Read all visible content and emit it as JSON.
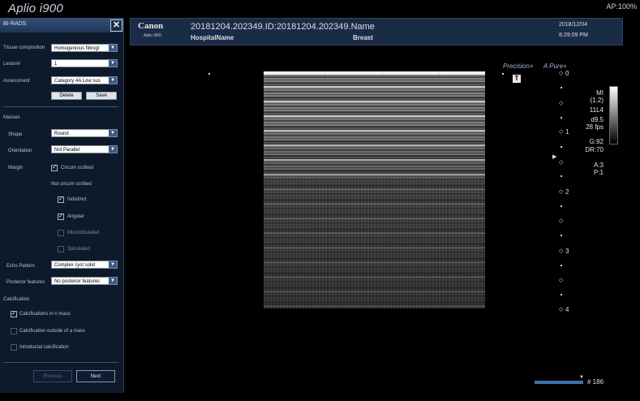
{
  "app": {
    "brand": "Aplio i900",
    "acoustic_power": "AP:100%"
  },
  "header": {
    "logo": "Canon",
    "model": "Aplio i900",
    "study_id": "20181204.202349.ID:20181204.202349.Name",
    "hospital": "HospitalName",
    "region": "Breast",
    "date": "2018/12/04",
    "time": "8:29:09 PM"
  },
  "panel": {
    "title": "BI-RADS",
    "tissue_composition_label": "Tissue composition",
    "tissue_composition_value": "Homogenious fibrogl",
    "lesion_label": "Lesion#",
    "lesion_value": "1",
    "assessment_label": "Assessment",
    "assessment_value": "Category 4A Low sus",
    "delete_label": "Delete",
    "save_label": "Save",
    "masses_heading": "Masses",
    "shape_label": "Shape",
    "shape_value": "Round",
    "orientation_label": "Orientation",
    "orientation_value": "Not Parallel",
    "margin_label": "Margin",
    "circumscribed_label": "Circum scribed",
    "not_circumscribed_label": "Not circum scribed",
    "indistinct_label": "Indistinct",
    "angular_label": "Angular",
    "microlobulated_label": "Microlobulated",
    "spiculated_label": "Spiculated",
    "echo_pattern_label": "Echo Pattern",
    "echo_pattern_value": "Complex cyst solid",
    "posterior_label": "Posterior features",
    "posterior_value": "No posterior features",
    "calcification_heading": "Calcification",
    "calc_in_mass_label": "Calcifications in n mass",
    "calc_outside_label": "Calcification outside of a mass",
    "intraductal_label": "Introductal calcification",
    "previous_label": "Previous",
    "next_label": "Next",
    "checks": {
      "circumscribed": true,
      "indistinct": true,
      "angular": true,
      "microlobulated": false,
      "spiculated": false,
      "calc_in_mass": true,
      "calc_outside": false,
      "intraductal": false
    }
  },
  "overlay": {
    "precision": "Precision+",
    "apure": "A Pure+",
    "t_marker": "T",
    "depth_labels": [
      "0",
      "1",
      "2",
      "3",
      "4"
    ],
    "params": {
      "mi": "MI",
      "mi_value": "(1.2)",
      "probe": "11L4",
      "depth": "d9.5",
      "fps": "28 fps",
      "gain": "G:92",
      "dr": "DR:70",
      "a": "A:3",
      "p": "P:1"
    },
    "frame_count": "# 186"
  }
}
